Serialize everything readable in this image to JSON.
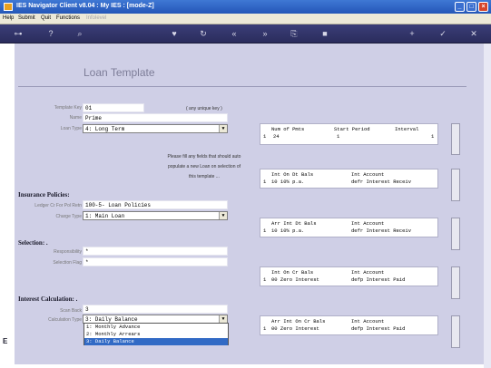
{
  "window": {
    "title": "IES Navigator Client v8.04 : My IES :      [mode-Z]"
  },
  "menu": {
    "help": "Help",
    "submit": "Submit",
    "quit": "Quit",
    "functions": "Functions",
    "disabled": "Infolevel"
  },
  "page": {
    "title": "Loan Template"
  },
  "form": {
    "template_key_label": "Template Key",
    "template_key": "01",
    "unique_hint": "( any unique key )",
    "name_label": "Name",
    "name": "Prime",
    "loan_type_label": "Loan Type",
    "loan_type": "4: Long Term",
    "hint_line1": "Please fill any fields that should auto",
    "hint_line2": "populate a new Loan on selection of",
    "hint_line3": "this template ..."
  },
  "insurance": {
    "heading": "Insurance Policies:",
    "ledger_label": "Ledger Cr For Pol Retn",
    "ledger_value": "100-5- Loan Policies",
    "charge_label": "Charge Type",
    "charge_value": "1: Main Loan"
  },
  "selection": {
    "heading": "Selection: .",
    "resp_label": "Responsibility",
    "resp_value": "*",
    "flag_label": "Selection Flag",
    "flag_value": "*"
  },
  "interest": {
    "heading": "Interest Calculation: .",
    "scan_label": "Scan Back",
    "scan_value": "3",
    "calc_label": "Calculation Type",
    "calc_value": "3: Daily Balance",
    "options": [
      "1: Monthly Advance",
      "2: Monthly Arrears",
      "3: Daily Balance"
    ]
  },
  "grids": {
    "pmts": {
      "h1": "Num of Pmts",
      "h2": "Start Period",
      "h3": "Interval",
      "idx": "1",
      "v1": "24",
      "v2": "1",
      "v3": "1"
    },
    "dt": {
      "h1": "Int On Dt Bals",
      "h2": "Int Account",
      "idx": "1",
      "v1": "10 10% p.a.",
      "v2": "defr Interest Receiv"
    },
    "arr": {
      "h1": "Arr Int Dt Bals",
      "h2": "Int Account",
      "idx": "1",
      "v1": "10 10% p.a.",
      "v2": "defr Interest Receiv"
    },
    "cr": {
      "h1": "Int On Cr Bals",
      "h2": "Int Account",
      "idx": "1",
      "v1": "00 Zero Interest",
      "v2": "defp Interest Paid"
    },
    "arrcr": {
      "h1": "Arr Int On Cr Bals",
      "h2": "Int Account",
      "idx": "1",
      "v1": "00 Zero Interest",
      "v2": "defp Interest Paid"
    }
  }
}
